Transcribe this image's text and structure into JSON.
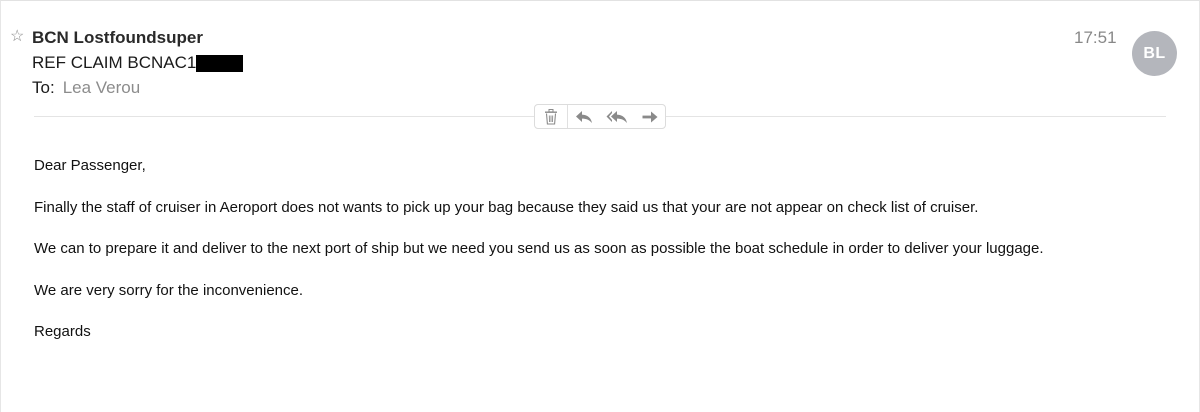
{
  "header": {
    "star_glyph": "☆",
    "sender": "BCN Lostfoundsuper",
    "subject": "REF CLAIM BCNAC1",
    "to_label": "To:",
    "to_value": "Lea Verou",
    "time": "17:51",
    "avatar_initials": "BL"
  },
  "toolbar": {
    "icons": [
      "trash-icon",
      "reply-icon",
      "reply-all-icon",
      "forward-icon"
    ]
  },
  "message": {
    "greeting": "Dear Passenger,",
    "paragraphs": [
      "Finally the staff of cruiser in Aeroport does not wants to pick up your bag  because they said us that your are not appear on check list of cruiser.",
      "We can to prepare it and  deliver to the next port of ship but we need you send us as soon as possible the boat  schedule  in order to deliver your luggage.",
      "We are very sorry for the inconvenience.",
      "Regards"
    ]
  },
  "colors": {
    "avatar_bg": "#b4b6bc",
    "muted_text": "#8c8c8c",
    "icon_gray": "#8a8a8a"
  }
}
